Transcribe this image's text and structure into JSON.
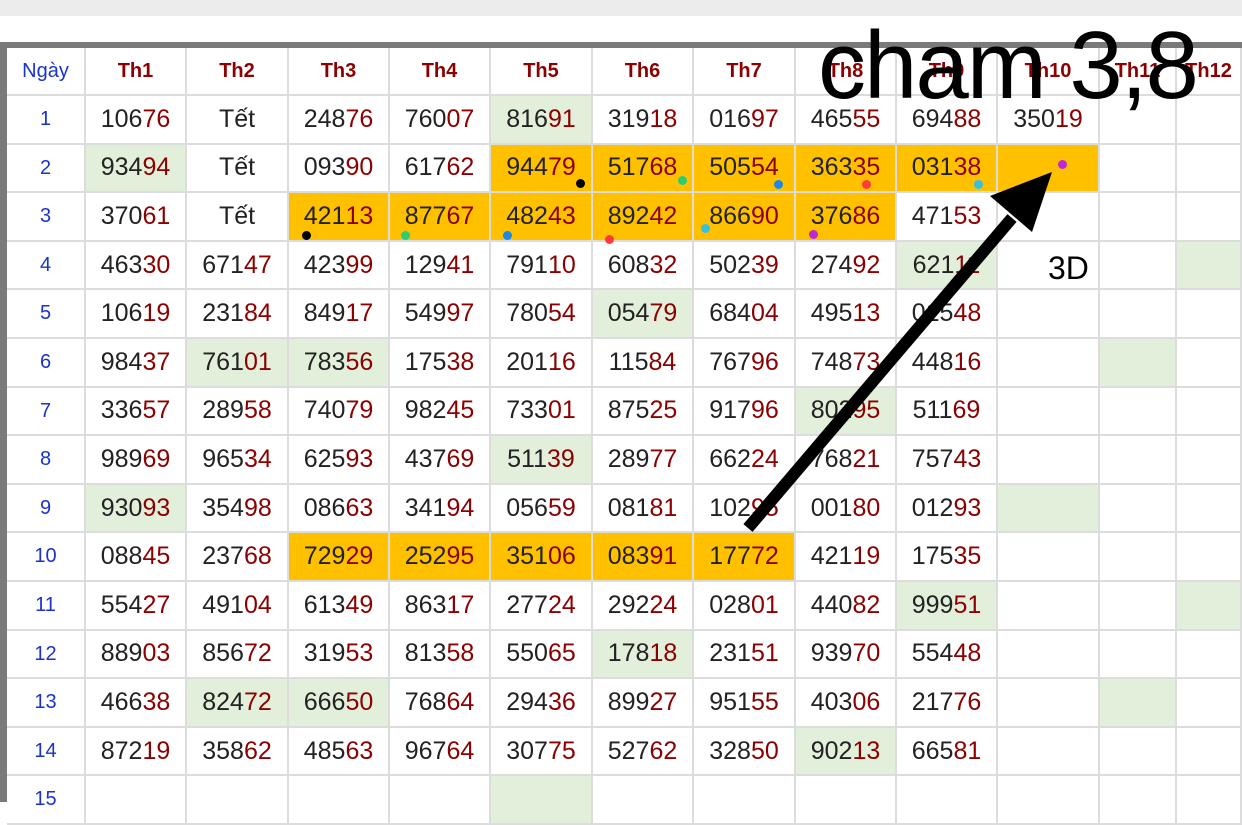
{
  "annotation": {
    "title": "cham 3,8",
    "label": "3D"
  },
  "colors": {
    "highlight_orange": "#ffc000",
    "highlight_green": "#e2efda",
    "header_red": "#8b0000",
    "day_blue": "#1a33cc"
  },
  "table": {
    "day_header": "Ngày",
    "month_headers": [
      "Th1",
      "Th2",
      "Th3",
      "Th4",
      "Th5",
      "Th6",
      "Th7",
      "Th8",
      "Th9",
      "Th10",
      "Th11",
      "Th12"
    ],
    "rows": [
      {
        "day": "1",
        "values": [
          "10676",
          "Tết",
          "24876",
          "76007",
          "81691",
          "31918",
          "01697",
          "46555",
          "69488",
          "35019",
          "",
          ""
        ]
      },
      {
        "day": "2",
        "values": [
          "93494",
          "Tết",
          "09390",
          "61762",
          "94479",
          "51768",
          "50554",
          "36335",
          "03138",
          "",
          "",
          ""
        ]
      },
      {
        "day": "3",
        "values": [
          "37061",
          "Tết",
          "42113",
          "87767",
          "48243",
          "89242",
          "86690",
          "37686",
          "47153",
          "",
          "",
          ""
        ]
      },
      {
        "day": "4",
        "values": [
          "46330",
          "67147",
          "42399",
          "12941",
          "79110",
          "60832",
          "50239",
          "27492",
          "62111",
          "",
          "",
          ""
        ]
      },
      {
        "day": "5",
        "values": [
          "10619",
          "23184",
          "84917",
          "54997",
          "78054",
          "05479",
          "68404",
          "49513",
          "01548",
          "",
          "",
          ""
        ]
      },
      {
        "day": "6",
        "values": [
          "98437",
          "76101",
          "78356",
          "17538",
          "20116",
          "11584",
          "76796",
          "74873",
          "44816",
          "",
          "",
          ""
        ]
      },
      {
        "day": "7",
        "values": [
          "33657",
          "28958",
          "74079",
          "98245",
          "73301",
          "87525",
          "91796",
          "80295",
          "51169",
          "",
          "",
          ""
        ]
      },
      {
        "day": "8",
        "values": [
          "98969",
          "96534",
          "62593",
          "43769",
          "51139",
          "28977",
          "66224",
          "76821",
          "75743",
          "",
          "",
          ""
        ]
      },
      {
        "day": "9",
        "values": [
          "93093",
          "35498",
          "08663",
          "34194",
          "05659",
          "08181",
          "10295",
          "00180",
          "01293",
          "",
          "",
          ""
        ]
      },
      {
        "day": "10",
        "values": [
          "08845",
          "23768",
          "72929",
          "25295",
          "35106",
          "08391",
          "17772",
          "42119",
          "17535",
          "",
          "",
          ""
        ]
      },
      {
        "day": "11",
        "values": [
          "55427",
          "49104",
          "61349",
          "86317",
          "27724",
          "29224",
          "02801",
          "44082",
          "99951",
          "",
          "",
          ""
        ]
      },
      {
        "day": "12",
        "values": [
          "88903",
          "85672",
          "31953",
          "81358",
          "55065",
          "17818",
          "23151",
          "93970",
          "55448",
          "",
          "",
          ""
        ]
      },
      {
        "day": "13",
        "values": [
          "46638",
          "82472",
          "66650",
          "76864",
          "29436",
          "89927",
          "95155",
          "40306",
          "21776",
          "",
          "",
          ""
        ]
      },
      {
        "day": "14",
        "values": [
          "87219",
          "35862",
          "48563",
          "96764",
          "30775",
          "52762",
          "32850",
          "90213",
          "66581",
          "",
          "",
          ""
        ]
      },
      {
        "day": "15",
        "values": [
          "",
          "",
          "",
          "",
          "",
          "",
          "",
          "",
          "",
          "",
          "",
          ""
        ]
      }
    ]
  }
}
